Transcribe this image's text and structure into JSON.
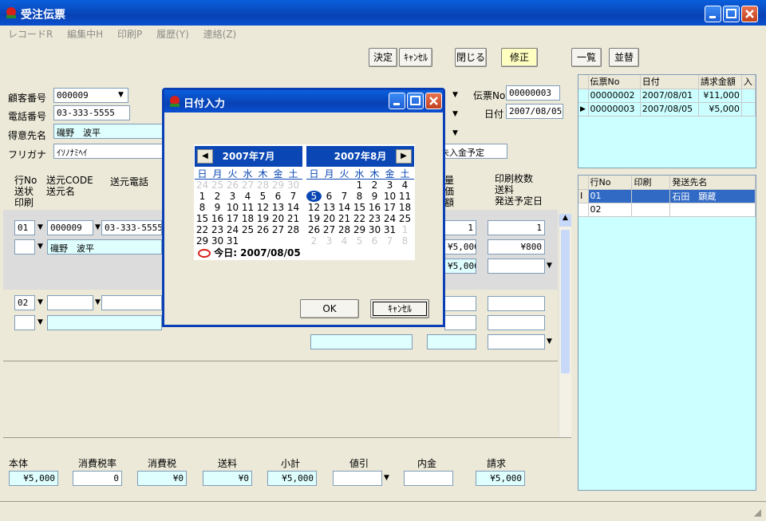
{
  "window": {
    "title": "受注伝票"
  },
  "menu": [
    "レコードR",
    "編集中H",
    "印刷P",
    "履歴(Y)",
    "連絡(Z)"
  ],
  "toolbar": {
    "decide": "決定",
    "cancel": "ｷｬﾝｾﾙ",
    "close": "閉じる",
    "mode": "修正",
    "list": "一覧",
    "sort": "並替"
  },
  "header": {
    "customer_no_label": "顧客番号",
    "customer_no": "000009",
    "phone_label": "電話番号",
    "phone": "03-333-5555",
    "client_label": "得意先名",
    "client": "磯野　波平",
    "kana_label": "フリガナ",
    "kana": "ｲｿﾉﾅﾐﾍｲ",
    "slip_no_label": "伝票No",
    "slip_no": "00000003",
    "date_label": "日付",
    "date": "2007/08/05",
    "payment_plan": "未入金予定"
  },
  "columns_left": {
    "row_no": "行No",
    "ship_status": "送状",
    "print": "印刷",
    "from_code": "送元CODE",
    "from_name": "送元名",
    "from_phone": "送元電話"
  },
  "columns_right": {
    "qty": "量",
    "price": "価",
    "amount": "額",
    "print_count": "印刷枚数",
    "shipping": "送料",
    "ship_date": "発送予定日"
  },
  "rows": [
    {
      "no": "01",
      "code": "000009",
      "phone": "03-333-5555",
      "name": "磯野　波平",
      "qty": "1",
      "print_count": "1",
      "price": "¥5,000",
      "shipping": "¥800",
      "amount": "¥5,000"
    },
    {
      "no": "02"
    }
  ],
  "footer": {
    "labels": [
      "本体",
      "消費税率",
      "消費税",
      "送料",
      "小計",
      "値引",
      "内金",
      "請求"
    ],
    "values": [
      "¥5,000",
      "0",
      "¥0",
      "¥0",
      "¥5,000",
      "",
      "",
      "¥5,000"
    ]
  },
  "slip_grid": {
    "headers": [
      "伝票No",
      "日付",
      "請求金額",
      "入"
    ],
    "rows": [
      [
        "00000002",
        "2007/08/01",
        "¥11,000"
      ],
      [
        "00000003",
        "2007/08/05",
        "¥5,000"
      ]
    ]
  },
  "dest_grid": {
    "headers": [
      "行No",
      "印刷",
      "発送先名"
    ],
    "rows": [
      [
        "01",
        "",
        "石田　顕蔵"
      ],
      [
        "02",
        "",
        ""
      ]
    ]
  },
  "date_dialog": {
    "title": "日付入力",
    "month1": "2007年7月",
    "month2": "2007年8月",
    "weekdays": [
      "日",
      "月",
      "火",
      "水",
      "木",
      "金",
      "土"
    ],
    "today_label": "今日: 2007/08/05",
    "ok": "OK",
    "cancel": "ｷｬﾝｾﾙ",
    "selected_day": 5
  },
  "colors": {
    "title_blue": "#0a47b4",
    "cyan_field": "#dffefe",
    "mode_yellow": "#ffffc0"
  }
}
